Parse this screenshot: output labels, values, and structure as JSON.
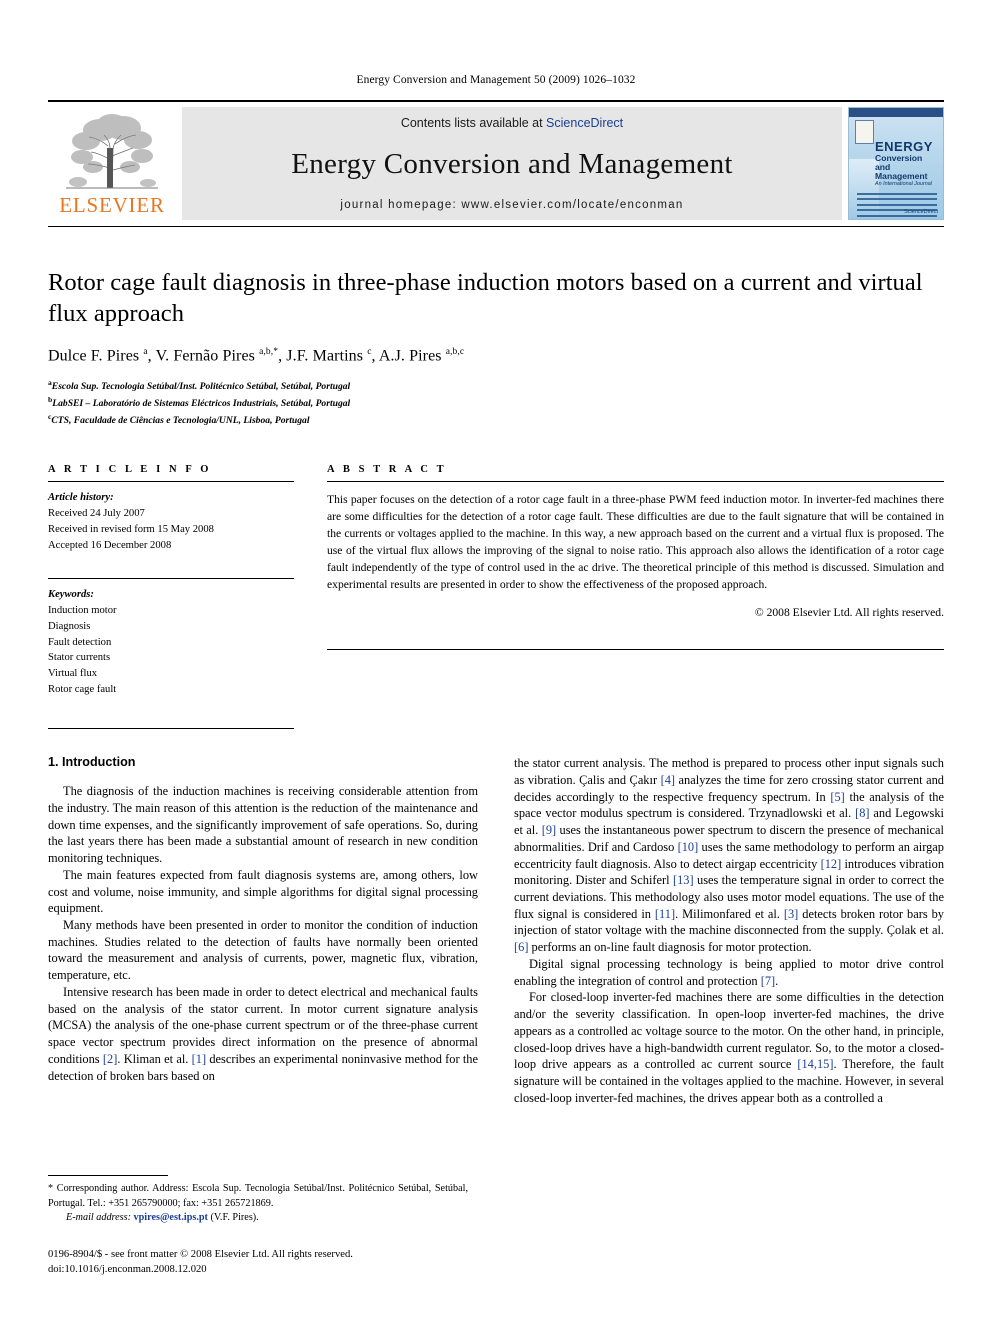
{
  "running_head": "Energy Conversion and Management 50 (2009) 1026–1032",
  "masthead": {
    "contents_prefix": "Contents lists available at ",
    "sciencedirect": "ScienceDirect",
    "journal_name": "Energy Conversion and Management",
    "homepage": "journal homepage: www.elsevier.com/locate/enconman",
    "publisher_logo_text": "ELSEVIER",
    "cover": {
      "line1": "ENERGY",
      "line2": "Conversion and",
      "line3": "Management",
      "line4": "An International Journal",
      "footer": "ScienceDirect"
    }
  },
  "article": {
    "title": "Rotor cage fault diagnosis in three-phase induction motors based on a current and virtual flux approach",
    "authors_html": "Dulce F. Pires <sup>a</sup>, V. Fernão Pires <sup>a,b,</sup><sup>*</sup>, J.F. Martins <sup>c</sup>, A.J. Pires <sup>a,b,c</sup>",
    "affiliations": [
      "Escola Sup. Tecnologia Setúbal/Inst. Politécnico Setúbal, Setúbal, Portugal",
      "LabSEI – Laboratório de Sistemas Eléctricos Industriais, Setúbal, Portugal",
      "CTS, Faculdade de Ciências e Tecnologia/UNL, Lisboa, Portugal"
    ],
    "affiliation_marks": [
      "a",
      "b",
      "c"
    ]
  },
  "info": {
    "heading": "A R T I C L E    I N F O",
    "history_label": "Article history:",
    "history": [
      "Received 24 July 2007",
      "Received in revised form 15 May 2008",
      "Accepted 16 December 2008"
    ],
    "keywords_label": "Keywords:",
    "keywords": [
      "Induction motor",
      "Diagnosis",
      "Fault detection",
      "Stator currents",
      "Virtual flux",
      "Rotor cage fault"
    ]
  },
  "abstract": {
    "heading": "A B S T R A C T",
    "text": "This paper focuses on the detection of a rotor cage fault in a three-phase PWM feed induction motor. In inverter-fed machines there are some difficulties for the detection of a rotor cage fault. These difficulties are due to the fault signature that will be contained in the currents or voltages applied to the machine. In this way, a new approach based on the current and a virtual flux is proposed. The use of the virtual flux allows the improving of the signal to noise ratio. This approach also allows the identification of a rotor cage fault independently of the type of control used in the ac drive. The theoretical principle of this method is discussed. Simulation and experimental results are presented in order to show the effectiveness of the proposed approach.",
    "copyright": "© 2008 Elsevier Ltd. All rights reserved."
  },
  "body": {
    "section_title": "1. Introduction",
    "left_paragraphs": [
      "The diagnosis of the induction machines is receiving considerable attention from the industry. The main reason of this attention is the reduction of the maintenance and down time expenses, and the significantly improvement of safe operations. So, during the last years there has been made a substantial amount of research in new condition monitoring techniques.",
      "The main features expected from fault diagnosis systems are, among others, low cost and volume, noise immunity, and simple algorithms for digital signal processing equipment.",
      "Many methods have been presented in order to monitor the condition of induction machines. Studies related to the detection of faults have normally been oriented toward the measurement and analysis of currents, power, magnetic flux, vibration, temperature, etc."
    ],
    "left_last_paragraph_parts": [
      "Intensive research has been made in order to detect electrical and mechanical faults based on the analysis of the stator current. In motor current signature analysis (MCSA) the analysis of the one-phase current spectrum or of the three-phase current space vector spectrum provides direct information on the presence of abnormal conditions ",
      "[2]",
      ". Kliman et al. ",
      "[1]",
      " describes an experimental noninvasive method for the detection of broken bars based on"
    ],
    "right_paragraph_1_parts": [
      "the stator current analysis. The method is prepared to process other input signals such as vibration. Çalis and Çakır ",
      "[4]",
      " analyzes the time for zero crossing stator current and decides accordingly to the respective frequency spectrum. In ",
      "[5]",
      " the analysis of the space vector modulus spectrum is considered. Trzynadlowski et al. ",
      "[8]",
      " and Legowski et al. ",
      "[9]",
      " uses the instantaneous power spectrum to discern the presence of mechanical abnormalities. Drif and Cardoso ",
      "[10]",
      " uses the same methodology to perform an airgap eccentricity fault diagnosis. Also to detect airgap eccentricity ",
      "[12]",
      " introduces vibration monitoring. Dister and Schiferl ",
      "[13]",
      " uses the temperature signal in order to correct the current deviations. This methodology also uses motor model equations. The use of the flux signal is considered in ",
      "[11]",
      ". Milimonfared et al. ",
      "[3]",
      " detects broken rotor bars by injection of stator voltage with the machine disconnected from the supply. Çolak et al. ",
      "[6]",
      " performs an on-line fault diagnosis for motor protection."
    ],
    "right_paragraph_2_parts": [
      "Digital signal processing technology is being applied to motor drive control enabling the integration of control and protection ",
      "[7]",
      "."
    ],
    "right_paragraph_3_parts": [
      "For closed-loop inverter-fed machines there are some difficulties in the detection and/or the severity classification. In open-loop inverter-fed machines, the drive appears as a controlled ac voltage source to the motor. On the other hand, in principle, closed-loop drives have a high-bandwidth current regulator. So, to the motor a closed-loop drive appears as a controlled ac current source ",
      "[14,15]",
      ". Therefore, the fault signature will be contained in the voltages applied to the machine. However, in several closed-loop inverter-fed machines, the drives appear both as a controlled a"
    ]
  },
  "footnote": {
    "corresponding": "* Corresponding author. Address: Escola Sup. Tecnologia Setúbal/Inst. Politécnico Setúbal, Setúbal, Portugal. Tel.: +351 265790000; fax: +351 265721869.",
    "email_label": "E-mail address:",
    "email": "vpires@est.ips.pt",
    "email_suffix": "(V.F. Pires)."
  },
  "imprint": {
    "line1": "0196-8904/$ - see front matter © 2008 Elsevier Ltd. All rights reserved.",
    "line2": "doi:10.1016/j.enconman.2008.12.020"
  },
  "colors": {
    "link": "#1b3f94",
    "elsevier_orange": "#E87722",
    "band_gray": "#e6e6e6"
  }
}
